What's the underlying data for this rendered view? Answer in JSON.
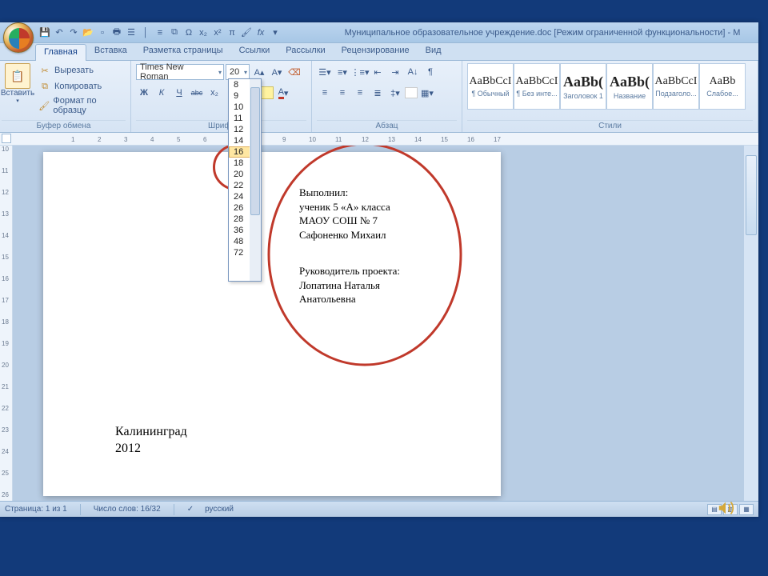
{
  "title": "Муниципальное образовательное учреждение.doc [Режим ограниченной функциональности] - M",
  "tabs": [
    "Главная",
    "Вставка",
    "Разметка страницы",
    "Ссылки",
    "Рассылки",
    "Рецензирование",
    "Вид"
  ],
  "clipboard": {
    "paste": "Вставить",
    "cut": "Вырезать",
    "copy": "Копировать",
    "format": "Формат по образцу",
    "label": "Буфер обмена"
  },
  "font": {
    "name": "Times New Roman",
    "size": "20",
    "label": "Шрифт",
    "bold": "Ж",
    "italic": "К",
    "underline": "Ч",
    "strike": "abc",
    "sub": "x₂",
    "sup": "x²"
  },
  "size_options": [
    "8",
    "9",
    "10",
    "11",
    "12",
    "14",
    "16",
    "18",
    "20",
    "22",
    "24",
    "26",
    "28",
    "36",
    "48",
    "72"
  ],
  "size_hover": "16",
  "paragraph": {
    "label": "Абзац"
  },
  "styles": {
    "label": "Стили",
    "items": [
      {
        "preview": "AaBbCcI",
        "name": "¶ Обычный",
        "big": false
      },
      {
        "preview": "AaBbCcI",
        "name": "¶ Без инте...",
        "big": false
      },
      {
        "preview": "AaBb(",
        "name": "Заголовок 1",
        "big": true
      },
      {
        "preview": "AaBb(",
        "name": "Название",
        "big": true
      },
      {
        "preview": "AaBbCcI",
        "name": "Подзаголо...",
        "big": false
      },
      {
        "preview": "AaBb",
        "name": "Слабое...",
        "big": false
      }
    ]
  },
  "document": {
    "block1": [
      "Выполнил:",
      "ученик 5 «А» класса",
      "МАОУ СОШ № 7",
      "Сафоненко Михаил"
    ],
    "block2": [
      "Руководитель проекта:",
      "Лопатина Наталья",
      "Анатольевна"
    ],
    "block3": [
      "Калининград",
      "2012"
    ]
  },
  "status": {
    "page": "Страница: 1 из 1",
    "words": "Число слов: 16/32",
    "lang": "русский"
  }
}
